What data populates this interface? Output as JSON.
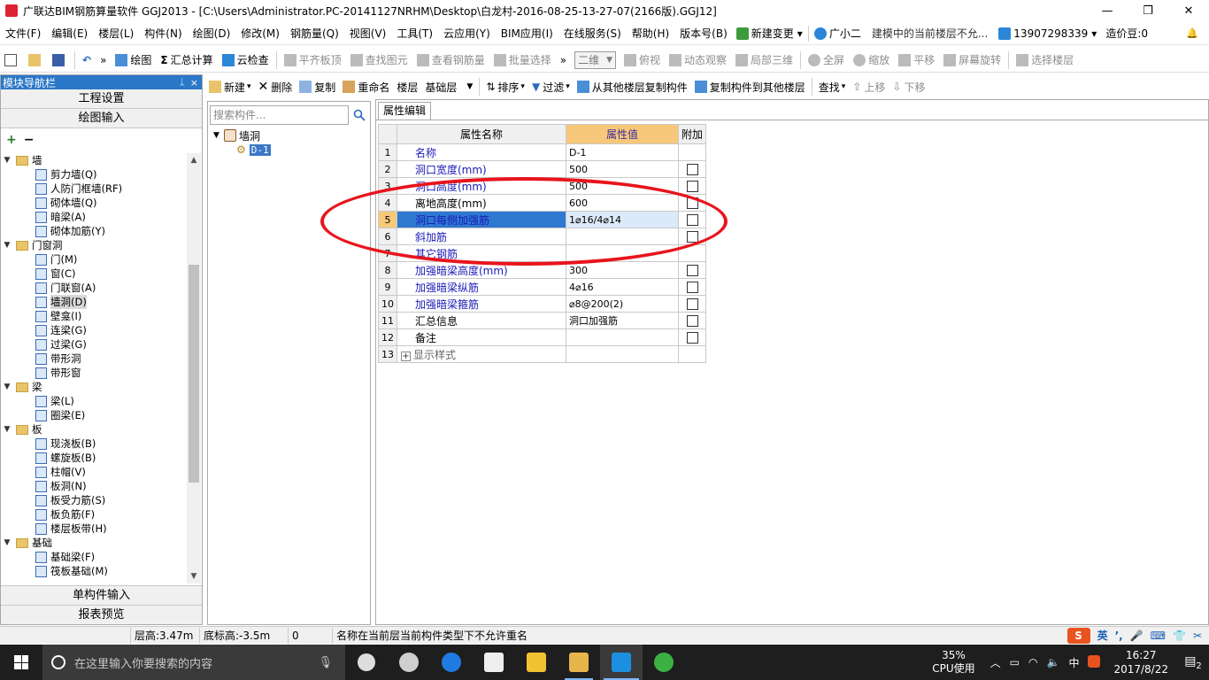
{
  "window": {
    "title": "广联达BIM钢筋算量软件 GGJ2013 - [C:\\Users\\Administrator.PC-20141127NRHM\\Desktop\\白龙村-2016-08-25-13-27-07(2166版).GGJ12]",
    "min": "—",
    "max": "❐",
    "close": "✕"
  },
  "menu": {
    "items": [
      "文件(F)",
      "编辑(E)",
      "楼层(L)",
      "构件(N)",
      "绘图(D)",
      "修改(M)",
      "钢筋量(Q)",
      "视图(V)",
      "工具(T)",
      "云应用(Y)",
      "BIM应用(I)",
      "在线服务(S)",
      "帮助(H)",
      "版本号(B)"
    ],
    "new_change": "新建变更",
    "new_change_arrow": "▾",
    "assistant": "广小二",
    "notice": "建模中的当前楼层不允...",
    "phone": "13907298339",
    "phone_arrow": "▾",
    "cost_bean": "造价豆:0",
    "bell": "🔔"
  },
  "toolbar1": {
    "draw": "绘图",
    "summary": "汇总计算",
    "cloud_check": "云检查",
    "align_slab": "平齐板顶",
    "find_element": "查找图元",
    "view_rebar": "查看钢筋量",
    "batch_select": "批量选择",
    "view_mode": "二维",
    "top_view": "俯视",
    "dynamic_view": "动态观察",
    "local_3d": "局部三维",
    "fullscreen": "全屏",
    "zoom": "缩放",
    "pan": "平移",
    "rotate": "屏幕旋转",
    "select_floor": "选择楼层",
    "chevron": "»"
  },
  "leftpanel": {
    "title": "模块导航栏",
    "pin": "ᛣ",
    "close": "×",
    "project_settings": "工程设置",
    "drawing_input": "绘图输入",
    "expand_all": "+",
    "collapse_all": "−",
    "tree": [
      {
        "label": "墙",
        "level": 0,
        "expanded": true
      },
      {
        "label": "剪力墙(Q)",
        "level": 1
      },
      {
        "label": "人防门框墙(RF)",
        "level": 1
      },
      {
        "label": "砌体墙(Q)",
        "level": 1
      },
      {
        "label": "暗梁(A)",
        "level": 1
      },
      {
        "label": "砌体加筋(Y)",
        "level": 1
      },
      {
        "label": "门窗洞",
        "level": 0,
        "expanded": true
      },
      {
        "label": "门(M)",
        "level": 1
      },
      {
        "label": "窗(C)",
        "level": 1
      },
      {
        "label": "门联窗(A)",
        "level": 1
      },
      {
        "label": "墙洞(D)",
        "level": 1,
        "selected": true
      },
      {
        "label": "壁龛(I)",
        "level": 1
      },
      {
        "label": "连梁(G)",
        "level": 1
      },
      {
        "label": "过梁(G)",
        "level": 1
      },
      {
        "label": "带形洞",
        "level": 1
      },
      {
        "label": "带形窗",
        "level": 1
      },
      {
        "label": "梁",
        "level": 0,
        "expanded": true
      },
      {
        "label": "梁(L)",
        "level": 1
      },
      {
        "label": "圈梁(E)",
        "level": 1
      },
      {
        "label": "板",
        "level": 0,
        "expanded": true
      },
      {
        "label": "现浇板(B)",
        "level": 1
      },
      {
        "label": "螺旋板(B)",
        "level": 1
      },
      {
        "label": "柱帽(V)",
        "level": 1
      },
      {
        "label": "板洞(N)",
        "level": 1
      },
      {
        "label": "板受力筋(S)",
        "level": 1
      },
      {
        "label": "板负筋(F)",
        "level": 1
      },
      {
        "label": "楼层板带(H)",
        "level": 1
      },
      {
        "label": "基础",
        "level": 0,
        "expanded": true
      },
      {
        "label": "基础梁(F)",
        "level": 1
      },
      {
        "label": "筏板基础(M)",
        "level": 1
      }
    ],
    "single_input": "单构件输入",
    "report_preview": "报表预览"
  },
  "comp_toolbar": {
    "new": "新建",
    "delete": "删除",
    "copy": "复制",
    "rename": "重命名",
    "floor_label": "楼层",
    "floor_value": "基础层",
    "sort": "排序",
    "filter": "过滤",
    "copy_from_other": "从其他楼层复制构件",
    "copy_to_other": "复制构件到其他楼层",
    "find": "查找",
    "move_up": "上移",
    "move_down": "下移"
  },
  "complist": {
    "search_placeholder": "搜索构件...",
    "category": "墙洞",
    "item": "D-1"
  },
  "props": {
    "tab": "属性编辑",
    "col_name": "属性名称",
    "col_value": "属性值",
    "col_attach": "附加",
    "rows": [
      {
        "idx": "1",
        "name": "名称",
        "value": "D-1",
        "blue": true,
        "check": false
      },
      {
        "idx": "2",
        "name": "洞口宽度(mm)",
        "value": "500",
        "blue": true,
        "check": true
      },
      {
        "idx": "3",
        "name": "洞口高度(mm)",
        "value": "500",
        "blue": true,
        "check": true
      },
      {
        "idx": "4",
        "name": "离地高度(mm)",
        "value": "600",
        "blue": false,
        "check": true
      },
      {
        "idx": "5",
        "name": "洞口每侧加强筋",
        "value": "1⌀16/4⌀14",
        "blue": true,
        "check": true,
        "selected": true
      },
      {
        "idx": "6",
        "name": "斜加筋",
        "value": "",
        "blue": true,
        "check": true
      },
      {
        "idx": "7",
        "name": "其它钢筋",
        "value": "",
        "blue": true,
        "check": false
      },
      {
        "idx": "8",
        "name": "加强暗梁高度(mm)",
        "value": "300",
        "blue": true,
        "check": true
      },
      {
        "idx": "9",
        "name": "加强暗梁纵筋",
        "value": "4⌀16",
        "blue": true,
        "check": true
      },
      {
        "idx": "10",
        "name": "加强暗梁箍筋",
        "value": "⌀8@200(2)",
        "blue": true,
        "check": true
      },
      {
        "idx": "11",
        "name": "汇总信息",
        "value": "洞口加强筋",
        "blue": false,
        "check": true
      },
      {
        "idx": "12",
        "name": "备注",
        "value": "",
        "blue": false,
        "check": true
      },
      {
        "idx": "13",
        "name": "显示样式",
        "value": "",
        "blue": false,
        "check": false,
        "expandable": true
      }
    ]
  },
  "status": {
    "floor_height": "层高:3.47m",
    "bottom_elev": "底标高:-3.5m",
    "count": "0",
    "message": "名称在当前层当前构件类型下不允许重名",
    "ime_lang": "英"
  },
  "taskbar": {
    "search_placeholder": "在这里输入你要搜索的内容",
    "cpu_pct": "35%",
    "cpu_label": "CPU使用",
    "ime": "中",
    "time": "16:27",
    "date": "2017/8/22",
    "notif_count": "2"
  },
  "colors": {
    "annotation": "#e8141c",
    "selected_row": "#2f78d0",
    "header_value_bg": "#f7c87a"
  }
}
